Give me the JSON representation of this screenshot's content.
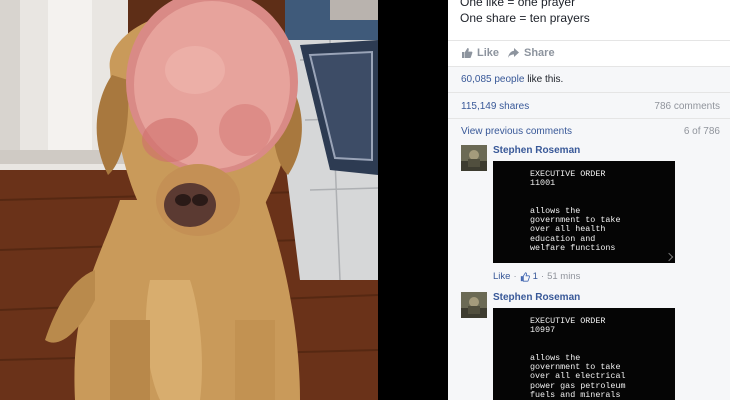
{
  "post": {
    "caption_lines": [
      "One like = one prayer",
      "One share = ten prayers"
    ],
    "actions": {
      "like_label": "Like",
      "share_label": "Share"
    },
    "likes": {
      "count": "60,085",
      "people_text": "people",
      "suffix": "like this."
    },
    "shares_text": "115,149 shares",
    "comments_count_text": "786 comments",
    "view_previous_label": "View previous comments",
    "pagination": "6 of 786"
  },
  "comments": [
    {
      "author": "Stephen Roseman",
      "image_text": {
        "title": "EXECUTIVE ORDER\n11001",
        "body": "allows the\ngovernment to take\nover all health\neducation and\nwelfare functions"
      },
      "like_label": "Like",
      "likes": "1",
      "time": "51 mins"
    },
    {
      "author": "Stephen Roseman",
      "image_text": {
        "title": "EXECUTIVE ORDER\n10997",
        "body": "allows the\ngovernment to take\nover all electrical\npower gas petroleum\nfuels and minerals"
      }
    }
  ],
  "colors": {
    "link": "#385898",
    "muted": "#90949c",
    "panel_bg": "#f6f7f9"
  }
}
